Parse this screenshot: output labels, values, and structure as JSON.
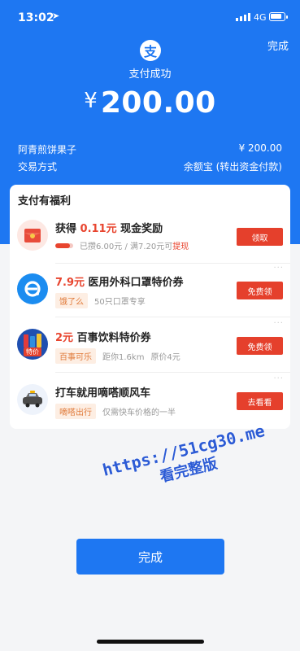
{
  "status_bar": {
    "time": "13:02",
    "location_glyph": "➤",
    "network": "4G"
  },
  "header": {
    "done_label": "完成",
    "logo_char": "支",
    "status_text": "支付成功",
    "currency": "¥",
    "amount": "200.00"
  },
  "details": [
    {
      "label": "阿青煎饼果子",
      "value": "¥ 200.00"
    },
    {
      "label": "交易方式",
      "value": "余额宝 (转出资金付款)"
    }
  ],
  "benefits": {
    "title": "支付有福利",
    "items": [
      {
        "icon": "red-envelope-icon",
        "title_prefix": "获得 ",
        "title_highlight": "0.11元",
        "title_suffix": " 现金奖励",
        "sub_text": "已攒6.00元 / 满7.20元可",
        "sub_link": "提现",
        "progress": 0.83,
        "button": "领取"
      },
      {
        "icon": "eleme-icon",
        "title_prefix": "",
        "title_highlight": "7.9元",
        "title_suffix": " 医用外科口罩特价券",
        "tag": "饿了么",
        "sub_text": "50只口罩专享",
        "button": "免费领",
        "dots": "···"
      },
      {
        "icon": "pepsi-drink-icon",
        "title_prefix": "",
        "title_highlight": "2元",
        "title_suffix": " 百事饮料特价券",
        "tag": "百事可乐",
        "distance": "距你1.6km",
        "original_price": "原价4元",
        "icon_label": "特价",
        "button": "免费领",
        "dots": "···"
      },
      {
        "icon": "carpool-car-icon",
        "title_prefix": "",
        "title_highlight": "",
        "title_suffix": "打车就用嘀嗒顺风车",
        "tag": "嘀嗒出行",
        "sub_text": "仅需快车价格的一半",
        "button": "去看看",
        "dots": "···"
      }
    ]
  },
  "bottom_button": "完成",
  "watermark": {
    "line1": "https://51cg30.me",
    "line2": "看完整版"
  },
  "colors": {
    "brand_blue": "#1e77f2",
    "action_red": "#e5402c",
    "highlight_red": "#e8452f"
  }
}
